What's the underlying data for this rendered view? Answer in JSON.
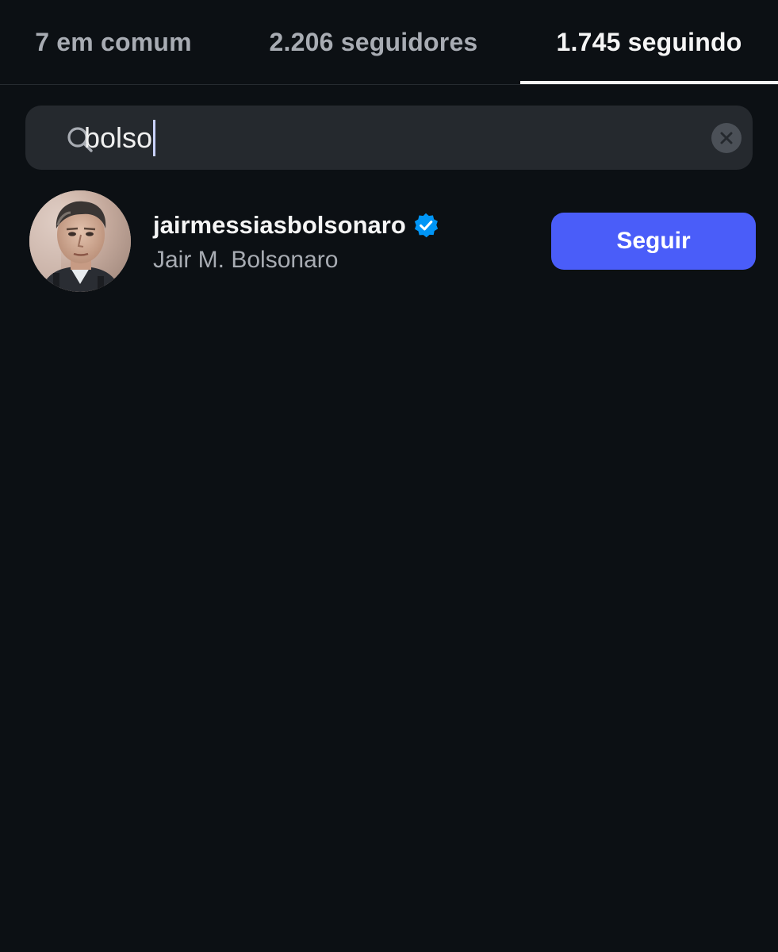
{
  "tabs": [
    {
      "label": "7 em comum",
      "active": false
    },
    {
      "label": "2.206 seguidores",
      "active": false
    },
    {
      "label": "1.745 seguindo",
      "active": true
    }
  ],
  "search": {
    "value": "bolso",
    "icon": "search-icon",
    "clear_icon": "clear-icon"
  },
  "results": [
    {
      "username": "jairmessiasbolsonaro",
      "verified": true,
      "full_name": "Jair M. Bolsonaro",
      "button_label": "Seguir"
    }
  ],
  "colors": {
    "background": "#0c1014",
    "search_bg": "#25292e",
    "accent_button": "#4a5df9",
    "verified_badge": "#0095f6",
    "text_primary": "#f5f5f5",
    "text_secondary": "#a8acb3"
  }
}
